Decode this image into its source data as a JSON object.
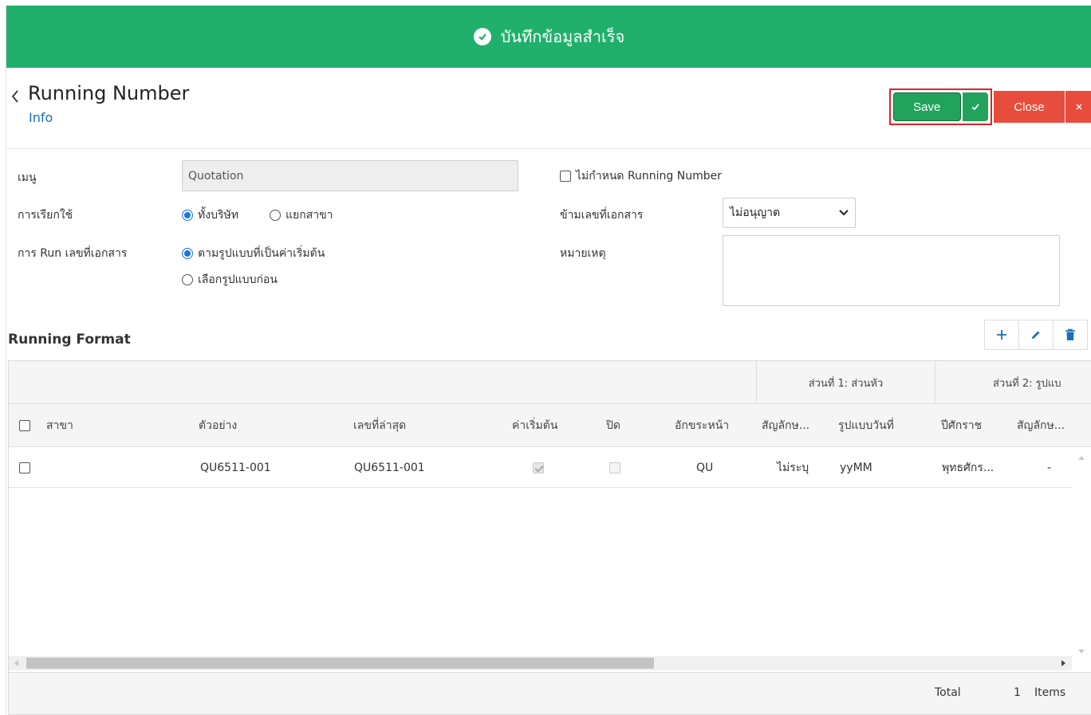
{
  "toast": {
    "message": "บันทึกข้อมูลสำเร็จ",
    "color": "#21b06b"
  },
  "header": {
    "title": "Running Number",
    "subtitle": "Info",
    "save_label": "Save",
    "close_label": "Close"
  },
  "form": {
    "menu_label": "เมนู",
    "menu_value": "Quotation",
    "usage_label": "การเรียกใช้",
    "usage_options": [
      {
        "label": "ทั้งบริษัท",
        "selected": true
      },
      {
        "label": "แยกสาขา",
        "selected": false
      }
    ],
    "run_label": "การ Run เลขที่เอกสาร",
    "run_options": [
      {
        "label": "ตามรูปแบบที่เป็นค่าเริ่มต้น",
        "selected": true
      },
      {
        "label": "เลือกรูปแบบก่อน",
        "selected": false
      }
    ],
    "no_running_number_label": "ไม่กำหนด Running Number",
    "skip_doc_label": "ข้ามเลขที่เอกสาร",
    "skip_doc_value": "ไม่อนุญาต",
    "note_label": "หมายเหตุ"
  },
  "running_format": {
    "title": "Running Format",
    "group_headers": [
      "ส่วนที่ 1: ส่วนหัว",
      "ส่วนที่ 2: รูปแบ"
    ],
    "columns": [
      "สาขา",
      "ตัวอย่าง",
      "เลขที่ล่าสุด",
      "ค่าเริ่มต้น",
      "ปิด",
      "อักขระหน้า",
      "สัญลักษ...",
      "รูปแบบวันที่",
      "ปีศักราช",
      "สัญลักษ..."
    ],
    "rows": [
      {
        "branch": "",
        "example": "QU6511-001",
        "latest": "QU6511-001",
        "is_default": true,
        "closed": false,
        "prefix": "QU",
        "symbol": "ไม่ระบุ",
        "date_format": "yyMM",
        "era": "พุทธศักร...",
        "symbol2": "-"
      }
    ],
    "footer": {
      "total_label": "Total",
      "count": "1",
      "items_label": "Items"
    }
  },
  "colors": {
    "save": "#21a35b",
    "close": "#e84c3d",
    "link": "#1a6fb8",
    "highlight": "#d9252a"
  }
}
